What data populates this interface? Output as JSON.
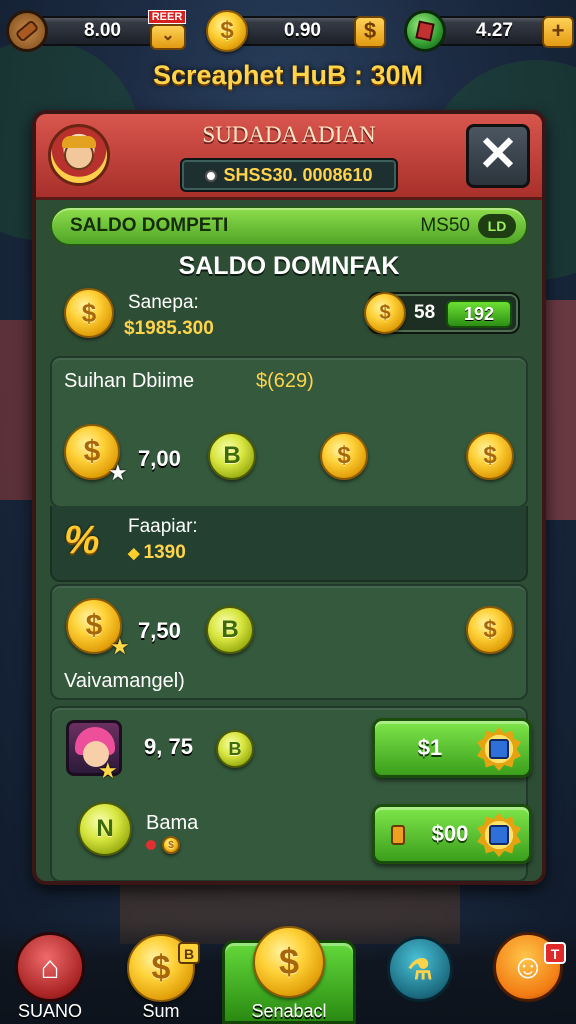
{
  "topbar": {
    "res1": {
      "value": "8.00",
      "icon": "wood-log-icon",
      "tag": "REER"
    },
    "res2": {
      "value": "0.90",
      "icon": "gold-coin-icon"
    },
    "res3": {
      "value": "4.27",
      "icon": "green-gem-icon"
    }
  },
  "hub_title": "Screaphet HuB : 30M",
  "panel": {
    "title": "SUDADA ADIAN",
    "subtitle": "SHSS30. 0008610",
    "close_label": "✕",
    "green_bar": {
      "left": "SALDO DOMPETI",
      "right": "MS50",
      "badge": "LD"
    },
    "heading": "SALDO DOMNFAK",
    "balance": {
      "label": "Sanepa:",
      "value": "$1985.300",
      "chip_value": "58",
      "chip_green": "192"
    },
    "card_a": {
      "label": "Suihan Dbiime",
      "value": "$(629)",
      "amount": "7,00"
    },
    "fapiar": {
      "label": "Faapiar:",
      "value": "1390",
      "icon_text": "%"
    },
    "card_b": {
      "amount": "7,50",
      "label": "Vaivamangel)"
    },
    "card_c": {
      "row1_amount": "9, 75",
      "row1_button": "$1",
      "row2_label": "Bama",
      "row2_button": "$00"
    }
  },
  "bottom_nav": {
    "item1": "SUANO",
    "item2": "Sum",
    "item2_badge": "B",
    "item3": "Senabacl",
    "item5_badge": "T"
  },
  "colors": {
    "accent_gold": "#ffd44a",
    "panel_green": "#2e4d35",
    "header_red": "#c2423b",
    "button_green": "#4fa526"
  }
}
